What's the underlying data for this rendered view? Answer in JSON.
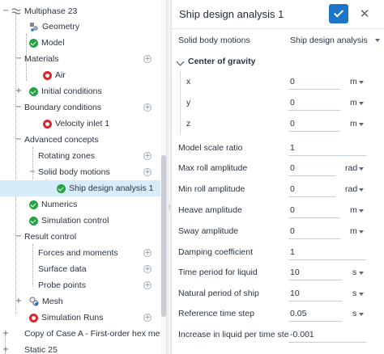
{
  "tree": {
    "root": {
      "label": "Multiphase 23"
    },
    "items": [
      {
        "key": "geometry",
        "label": "Geometry"
      },
      {
        "key": "model",
        "label": "Model"
      },
      {
        "key": "materials",
        "label": "Materials"
      },
      {
        "key": "air",
        "label": "Air"
      },
      {
        "key": "initial_conditions",
        "label": "Initial conditions"
      },
      {
        "key": "boundary_conditions",
        "label": "Boundary conditions"
      },
      {
        "key": "velocity_inlet",
        "label": "Velocity inlet 1"
      },
      {
        "key": "advanced_concepts",
        "label": "Advanced concepts"
      },
      {
        "key": "rotating_zones",
        "label": "Rotating zones"
      },
      {
        "key": "solid_body_motions",
        "label": "Solid body motions"
      },
      {
        "key": "ship_design_analysis",
        "label": "Ship design analysis 1"
      },
      {
        "key": "numerics",
        "label": "Numerics"
      },
      {
        "key": "simulation_control",
        "label": "Simulation control"
      },
      {
        "key": "result_control",
        "label": "Result control"
      },
      {
        "key": "forces_moments",
        "label": "Forces and moments"
      },
      {
        "key": "surface_data",
        "label": "Surface data"
      },
      {
        "key": "probe_points",
        "label": "Probe points"
      },
      {
        "key": "mesh",
        "label": "Mesh"
      },
      {
        "key": "simulation_runs",
        "label": "Simulation Runs"
      },
      {
        "key": "copy_case",
        "label": "Copy of Case A - First-order hex mes..."
      },
      {
        "key": "static",
        "label": "Static 25"
      }
    ]
  },
  "panel": {
    "title": "Ship design analysis 1",
    "solid_body_motions": {
      "label": "Solid body motions",
      "value": "Ship design analysis"
    },
    "center_of_gravity": {
      "label": "Center of gravity",
      "x": {
        "label": "x",
        "value": "0",
        "unit": "m"
      },
      "y": {
        "label": "y",
        "value": "0",
        "unit": "m"
      },
      "z": {
        "label": "z",
        "value": "0",
        "unit": "m"
      }
    },
    "model_scale_ratio": {
      "label": "Model scale ratio",
      "value": "1"
    },
    "max_roll_amplitude": {
      "label": "Max roll amplitude",
      "value": "0",
      "unit": "rad"
    },
    "min_roll_amplitude": {
      "label": "Min roll amplitude",
      "value": "0",
      "unit": "rad"
    },
    "heave_amplitude": {
      "label": "Heave amplitude",
      "value": "0",
      "unit": "m"
    },
    "sway_amplitude": {
      "label": "Sway amplitude",
      "value": "0",
      "unit": "m"
    },
    "damping_coefficient": {
      "label": "Damping coefficient",
      "value": "1"
    },
    "time_period_liquid": {
      "label": "Time period for liquid",
      "value": "10",
      "unit": "s"
    },
    "natural_period_ship": {
      "label": "Natural period of ship",
      "value": "10",
      "unit": "s"
    },
    "reference_time_step": {
      "label": "Reference time step",
      "value": "0.05",
      "unit": "s"
    },
    "increase_liquid": {
      "label": "Increase in liquid per time step",
      "value": "-0.001"
    }
  },
  "colors": {
    "accent": "#1c75c9",
    "selected_row": "#d7ecfb",
    "status_ok": "#26a243",
    "status_error": "#d9262c"
  },
  "icons": {
    "valid": "check-circle-icon",
    "invalid": "error-ring-icon",
    "geometry": "geometry-icon",
    "mesh": "mesh-icon",
    "add": "plus-icon",
    "expand": "toggle-icon"
  }
}
